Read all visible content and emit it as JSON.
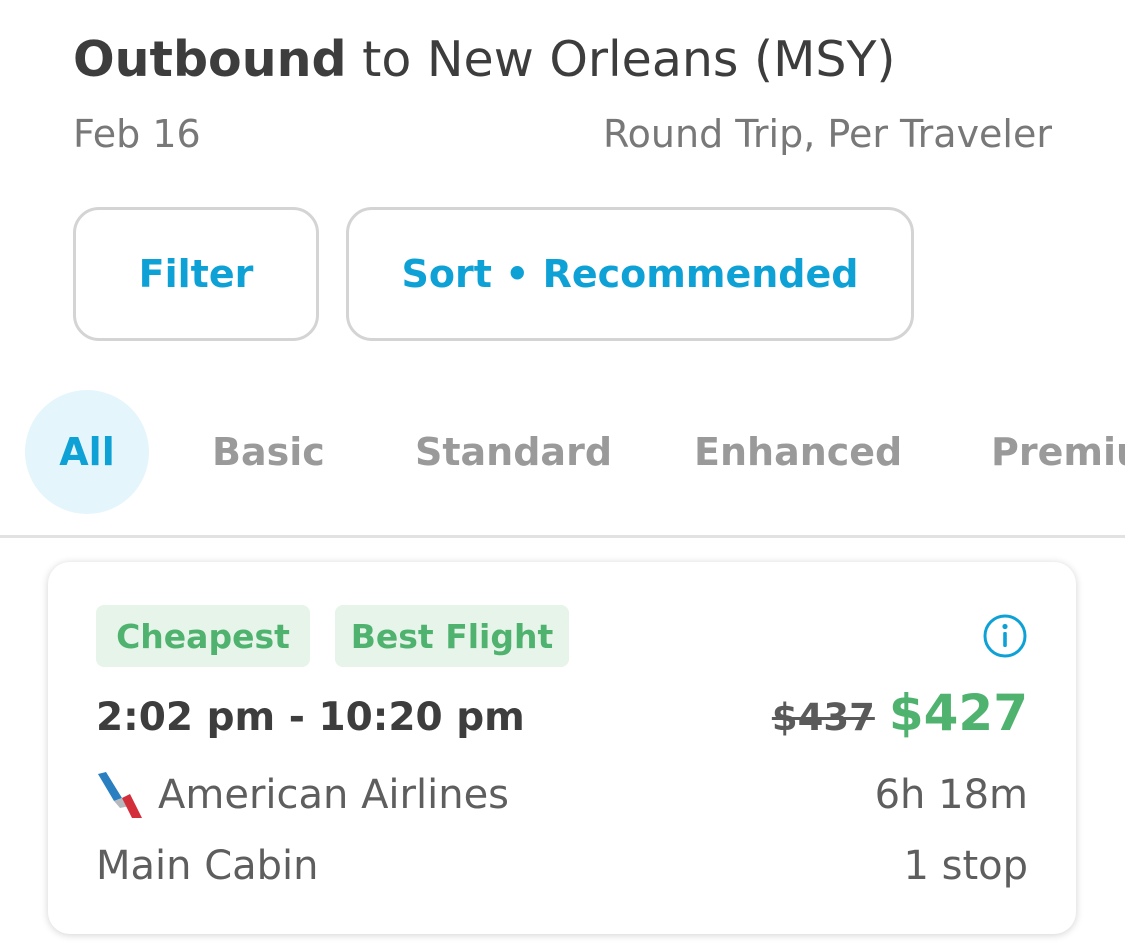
{
  "header": {
    "title_bold": "Outbound",
    "title_rest": " to New Orleans (MSY)",
    "date": "Feb 16",
    "trip_info": "Round Trip, Per Traveler"
  },
  "controls": {
    "filter_label": "Filter",
    "sort_label": "Sort • Recommended"
  },
  "tabs": [
    {
      "label": "All",
      "active": true
    },
    {
      "label": "Basic",
      "active": false
    },
    {
      "label": "Standard",
      "active": false
    },
    {
      "label": "Enhanced",
      "active": false
    },
    {
      "label": "Premiu",
      "active": false
    }
  ],
  "flight": {
    "badges": [
      "Cheapest",
      "Best Flight"
    ],
    "info_icon": "info-icon",
    "times": "2:02 pm - 10:20 pm",
    "original_price": "$437",
    "price": "$427",
    "airline": "American Airlines",
    "airline_icon": "american-airlines-logo",
    "duration": "6h 18m",
    "cabin": "Main Cabin",
    "stops": "1 stop"
  },
  "colors": {
    "accent": "#0ea1d6",
    "accent_light": "#e4f5fc",
    "success": "#4fb36f",
    "success_light": "#e6f4ea",
    "text_dark": "#3d3d3d",
    "text_muted": "#787878",
    "border": "#d4d4d4"
  }
}
